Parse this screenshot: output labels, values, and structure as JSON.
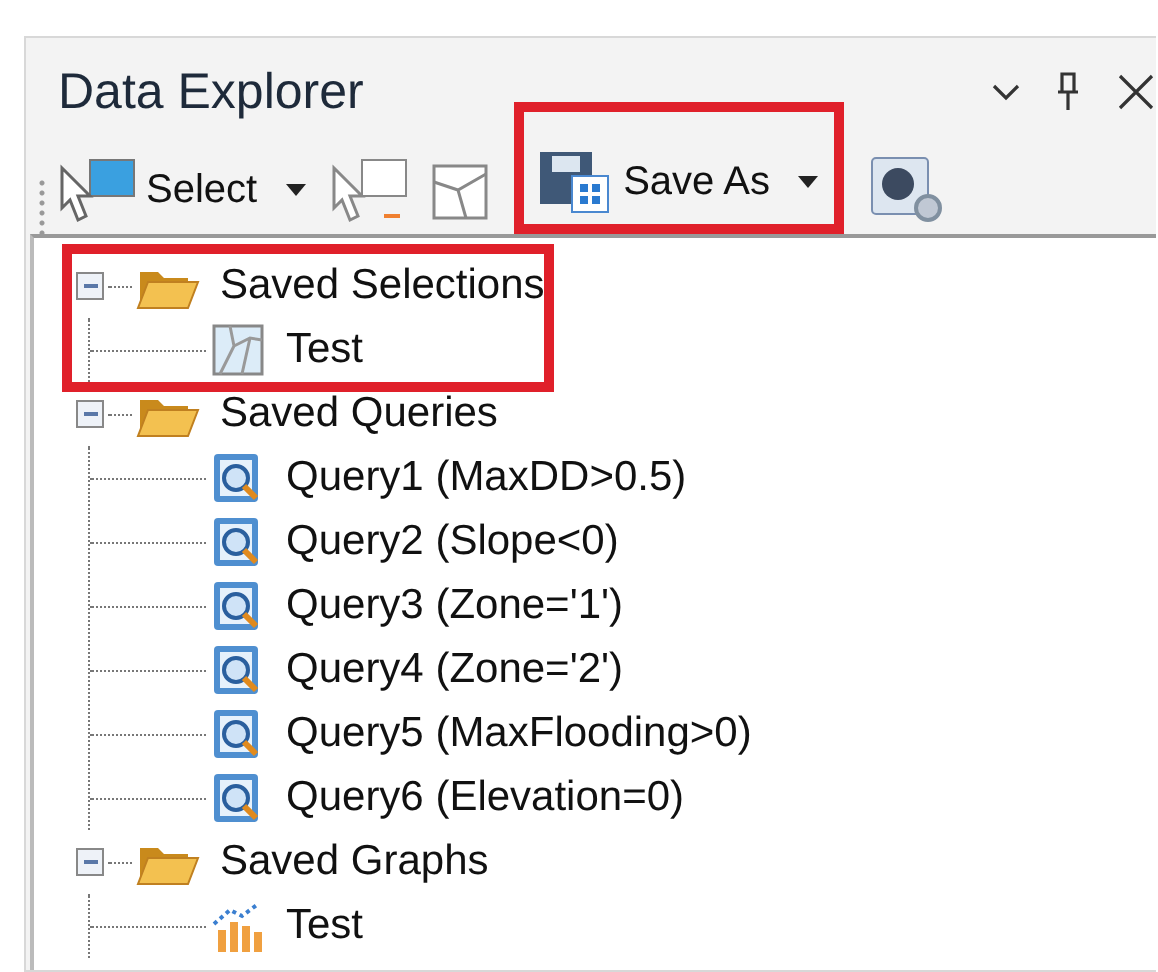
{
  "panel": {
    "title": "Data Explorer"
  },
  "toolbar": [
    {
      "kind": "select",
      "label": "Select",
      "dropdown": true,
      "highlighted": false
    },
    {
      "kind": "select-alt",
      "highlighted": false
    },
    {
      "kind": "polygon",
      "highlighted": false
    },
    {
      "kind": "save",
      "label": "Save As",
      "dropdown": true,
      "highlighted": true
    },
    {
      "kind": "settings",
      "highlighted": false
    }
  ],
  "tree": [
    {
      "label": "Saved Selections",
      "expanded": true,
      "highlighted": true,
      "children": [
        {
          "kind": "selection",
          "label": "Test"
        }
      ]
    },
    {
      "label": "Saved Queries",
      "expanded": true,
      "highlighted": false,
      "children": [
        {
          "kind": "query",
          "label": "Query1 (MaxDD>0.5)"
        },
        {
          "kind": "query",
          "label": "Query2 (Slope<0)"
        },
        {
          "kind": "query",
          "label": "Query3 (Zone='1')"
        },
        {
          "kind": "query",
          "label": "Query4 (Zone='2')"
        },
        {
          "kind": "query",
          "label": "Query5 (MaxFlooding>0)"
        },
        {
          "kind": "query",
          "label": "Query6 (Elevation=0)"
        }
      ]
    },
    {
      "label": "Saved Graphs",
      "expanded": true,
      "highlighted": false,
      "children": [
        {
          "kind": "graph",
          "label": "Test"
        }
      ]
    }
  ]
}
